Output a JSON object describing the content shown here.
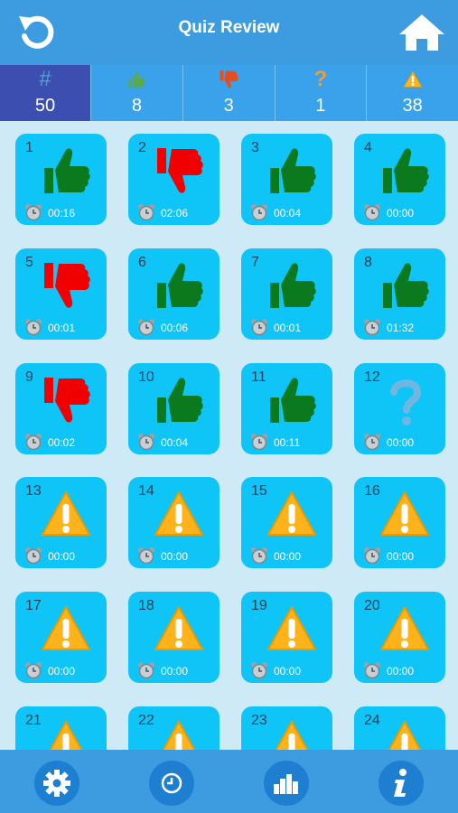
{
  "header": {
    "title": "Quiz Review"
  },
  "stats": [
    {
      "symbol": "#",
      "value": "50",
      "icon": "hash-icon"
    },
    {
      "symbol": "",
      "value": "8",
      "icon": "thumbs-up-icon"
    },
    {
      "symbol": "",
      "value": "3",
      "icon": "thumbs-down-icon"
    },
    {
      "symbol": "?",
      "value": "1",
      "icon": "question-icon"
    },
    {
      "symbol": "",
      "value": "38",
      "icon": "warning-icon"
    }
  ],
  "tiles": [
    {
      "n": "1",
      "t": "00:16",
      "s": "up"
    },
    {
      "n": "2",
      "t": "02:06",
      "s": "down"
    },
    {
      "n": "3",
      "t": "00:04",
      "s": "up"
    },
    {
      "n": "4",
      "t": "00:00",
      "s": "up"
    },
    {
      "n": "5",
      "t": "00:01",
      "s": "down"
    },
    {
      "n": "6",
      "t": "00:06",
      "s": "up"
    },
    {
      "n": "7",
      "t": "00:01",
      "s": "up"
    },
    {
      "n": "8",
      "t": "01:32",
      "s": "up"
    },
    {
      "n": "9",
      "t": "00:02",
      "s": "down"
    },
    {
      "n": "10",
      "t": "00:04",
      "s": "up"
    },
    {
      "n": "11",
      "t": "00:11",
      "s": "up"
    },
    {
      "n": "12",
      "t": "00:00",
      "s": "question"
    },
    {
      "n": "13",
      "t": "00:00",
      "s": "warning"
    },
    {
      "n": "14",
      "t": "00:00",
      "s": "warning"
    },
    {
      "n": "15",
      "t": "00:00",
      "s": "warning"
    },
    {
      "n": "16",
      "t": "00:00",
      "s": "warning"
    },
    {
      "n": "17",
      "t": "00:00",
      "s": "warning"
    },
    {
      "n": "18",
      "t": "00:00",
      "s": "warning"
    },
    {
      "n": "19",
      "t": "00:00",
      "s": "warning"
    },
    {
      "n": "20",
      "t": "00:00",
      "s": "warning"
    },
    {
      "n": "21",
      "t": "",
      "s": "warning"
    },
    {
      "n": "22",
      "t": "",
      "s": "warning"
    },
    {
      "n": "23",
      "t": "",
      "s": "warning"
    },
    {
      "n": "24",
      "t": "",
      "s": "warning"
    }
  ],
  "footer": {
    "buttons": [
      "settings-icon",
      "clock-icon",
      "stats-icon",
      "info-icon"
    ]
  },
  "colors": {
    "header": "#3d9be0",
    "tile": "#0fc4f7",
    "active_stat": "#3c4fb1",
    "up": "#0b7a1e",
    "down": "#f00000",
    "warning": "#ffb31a"
  }
}
